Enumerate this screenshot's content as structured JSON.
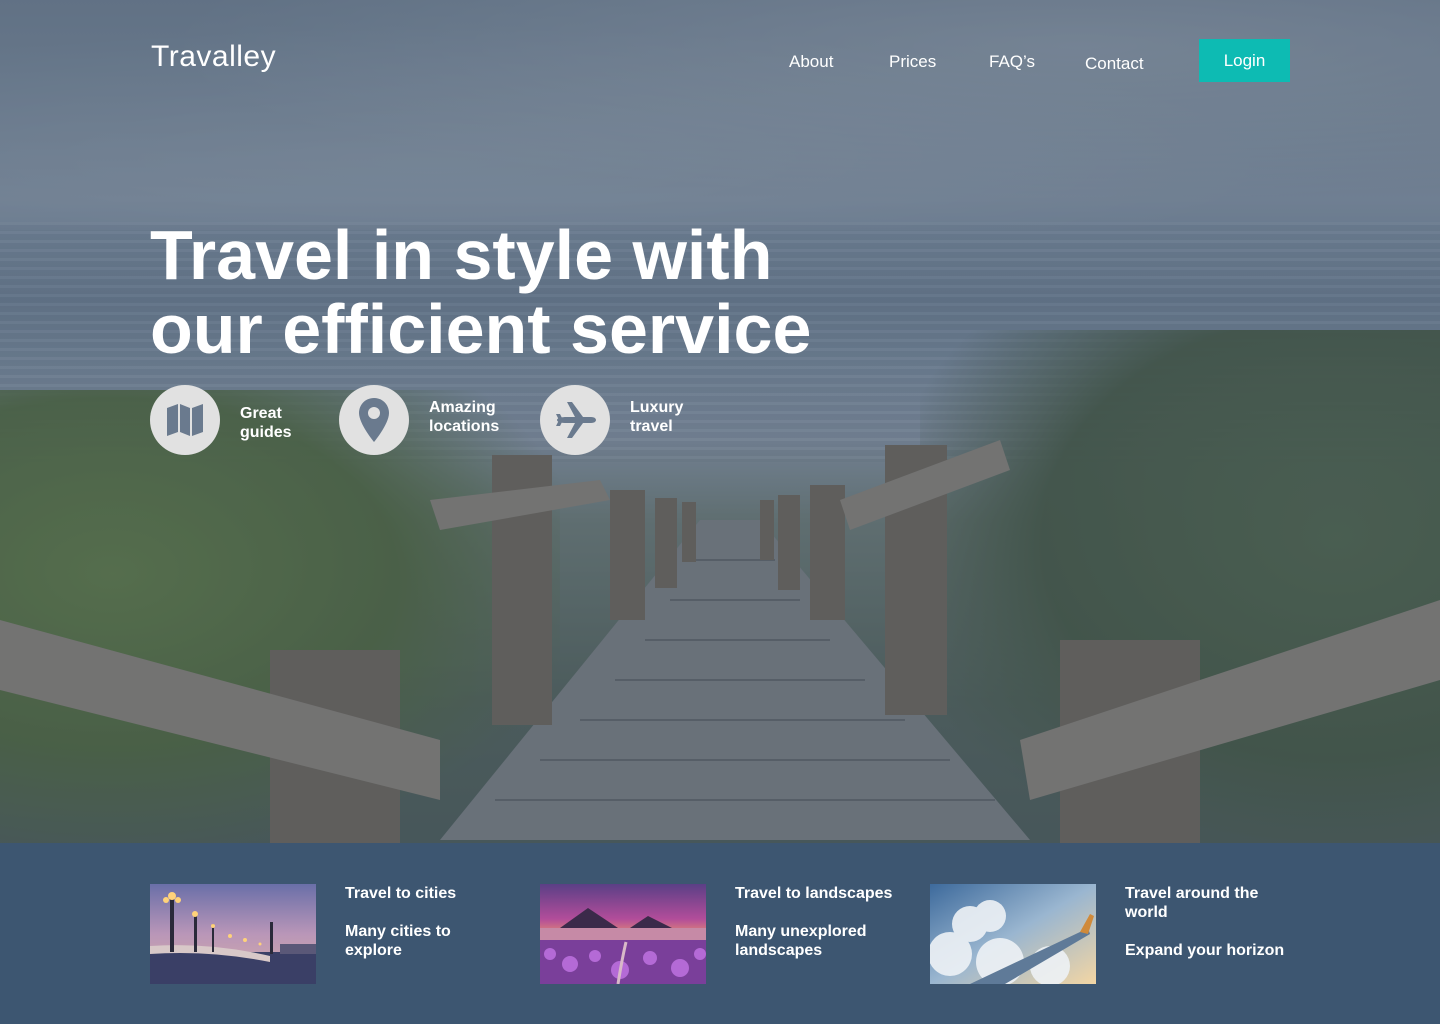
{
  "header": {
    "logo": "Travalley",
    "nav": [
      {
        "label": "About"
      },
      {
        "label": "Prices"
      },
      {
        "label": "FAQ’s"
      },
      {
        "label": "Contact"
      }
    ],
    "login_label": "Login"
  },
  "hero": {
    "headline_line1": "Travel in style with",
    "headline_line2": "our efficient service"
  },
  "features": [
    {
      "line1": "Great",
      "line2": "guides",
      "icon": "map-icon"
    },
    {
      "line1": "Amazing",
      "line2": "locations",
      "icon": "location-pin-icon"
    },
    {
      "line1": "Luxury",
      "line2": "travel",
      "icon": "airplane-icon"
    }
  ],
  "cards": [
    {
      "title": "Travel to cities",
      "subtitle_line1": "Many cities to",
      "subtitle_line2": "explore"
    },
    {
      "title": "Travel to landscapes",
      "subtitle_line1": "Many unexplored",
      "subtitle_line2": "landscapes"
    },
    {
      "title_line1": "Travel around the",
      "title_line2": "world",
      "subtitle": "Expand your horizon"
    }
  ],
  "colors": {
    "accent": "#0dbbb3",
    "strip": "#3d5671",
    "icon_circle": "#e1e1e1",
    "icon_glyph": "#6a7a8e"
  }
}
